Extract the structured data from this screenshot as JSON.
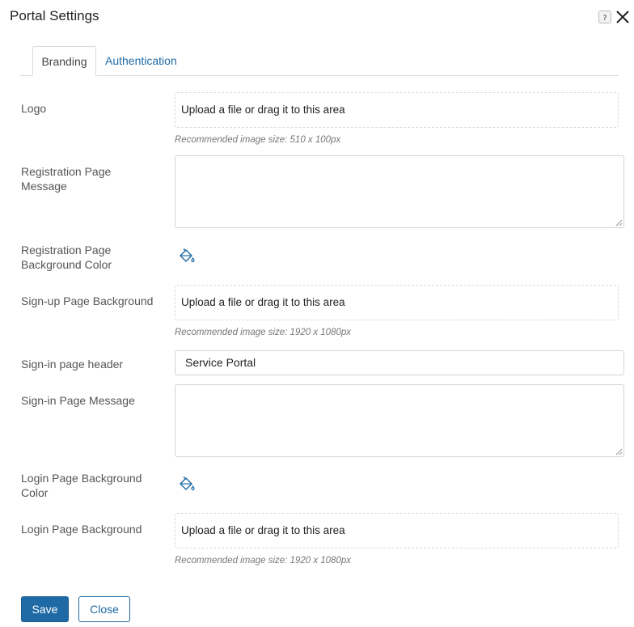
{
  "dialog": {
    "title": "Portal Settings"
  },
  "tabs": [
    {
      "label": "Branding",
      "active": true
    },
    {
      "label": "Authentication",
      "active": false
    }
  ],
  "fields": {
    "logo": {
      "label": "Logo",
      "dropzone_text": "Upload a file or drag it to this area",
      "hint": "Recommended image size: 510 x 100px"
    },
    "registration_message": {
      "label": "Registration Page Message",
      "value": ""
    },
    "registration_bg_color": {
      "label": "Registration Page Background Color",
      "icon": "paint-bucket-icon"
    },
    "signup_background": {
      "label": "Sign-up Page Background",
      "dropzone_text": "Upload a file or drag it to this area",
      "hint": "Recommended image size: 1920 x 1080px"
    },
    "signin_header": {
      "label": "Sign-in page header",
      "value": "Service Portal"
    },
    "signin_message": {
      "label": "Sign-in Page Message",
      "value": ""
    },
    "login_bg_color": {
      "label": "Login Page Background Color",
      "icon": "paint-bucket-icon"
    },
    "login_background": {
      "label": "Login Page Background",
      "dropzone_text": "Upload a file or drag it to this area",
      "hint": "Recommended image size: 1920 x 1080px"
    }
  },
  "buttons": {
    "save": "Save",
    "close": "Close"
  },
  "colors": {
    "accent": "#1f6aa5",
    "border": "#d4d4d4"
  }
}
